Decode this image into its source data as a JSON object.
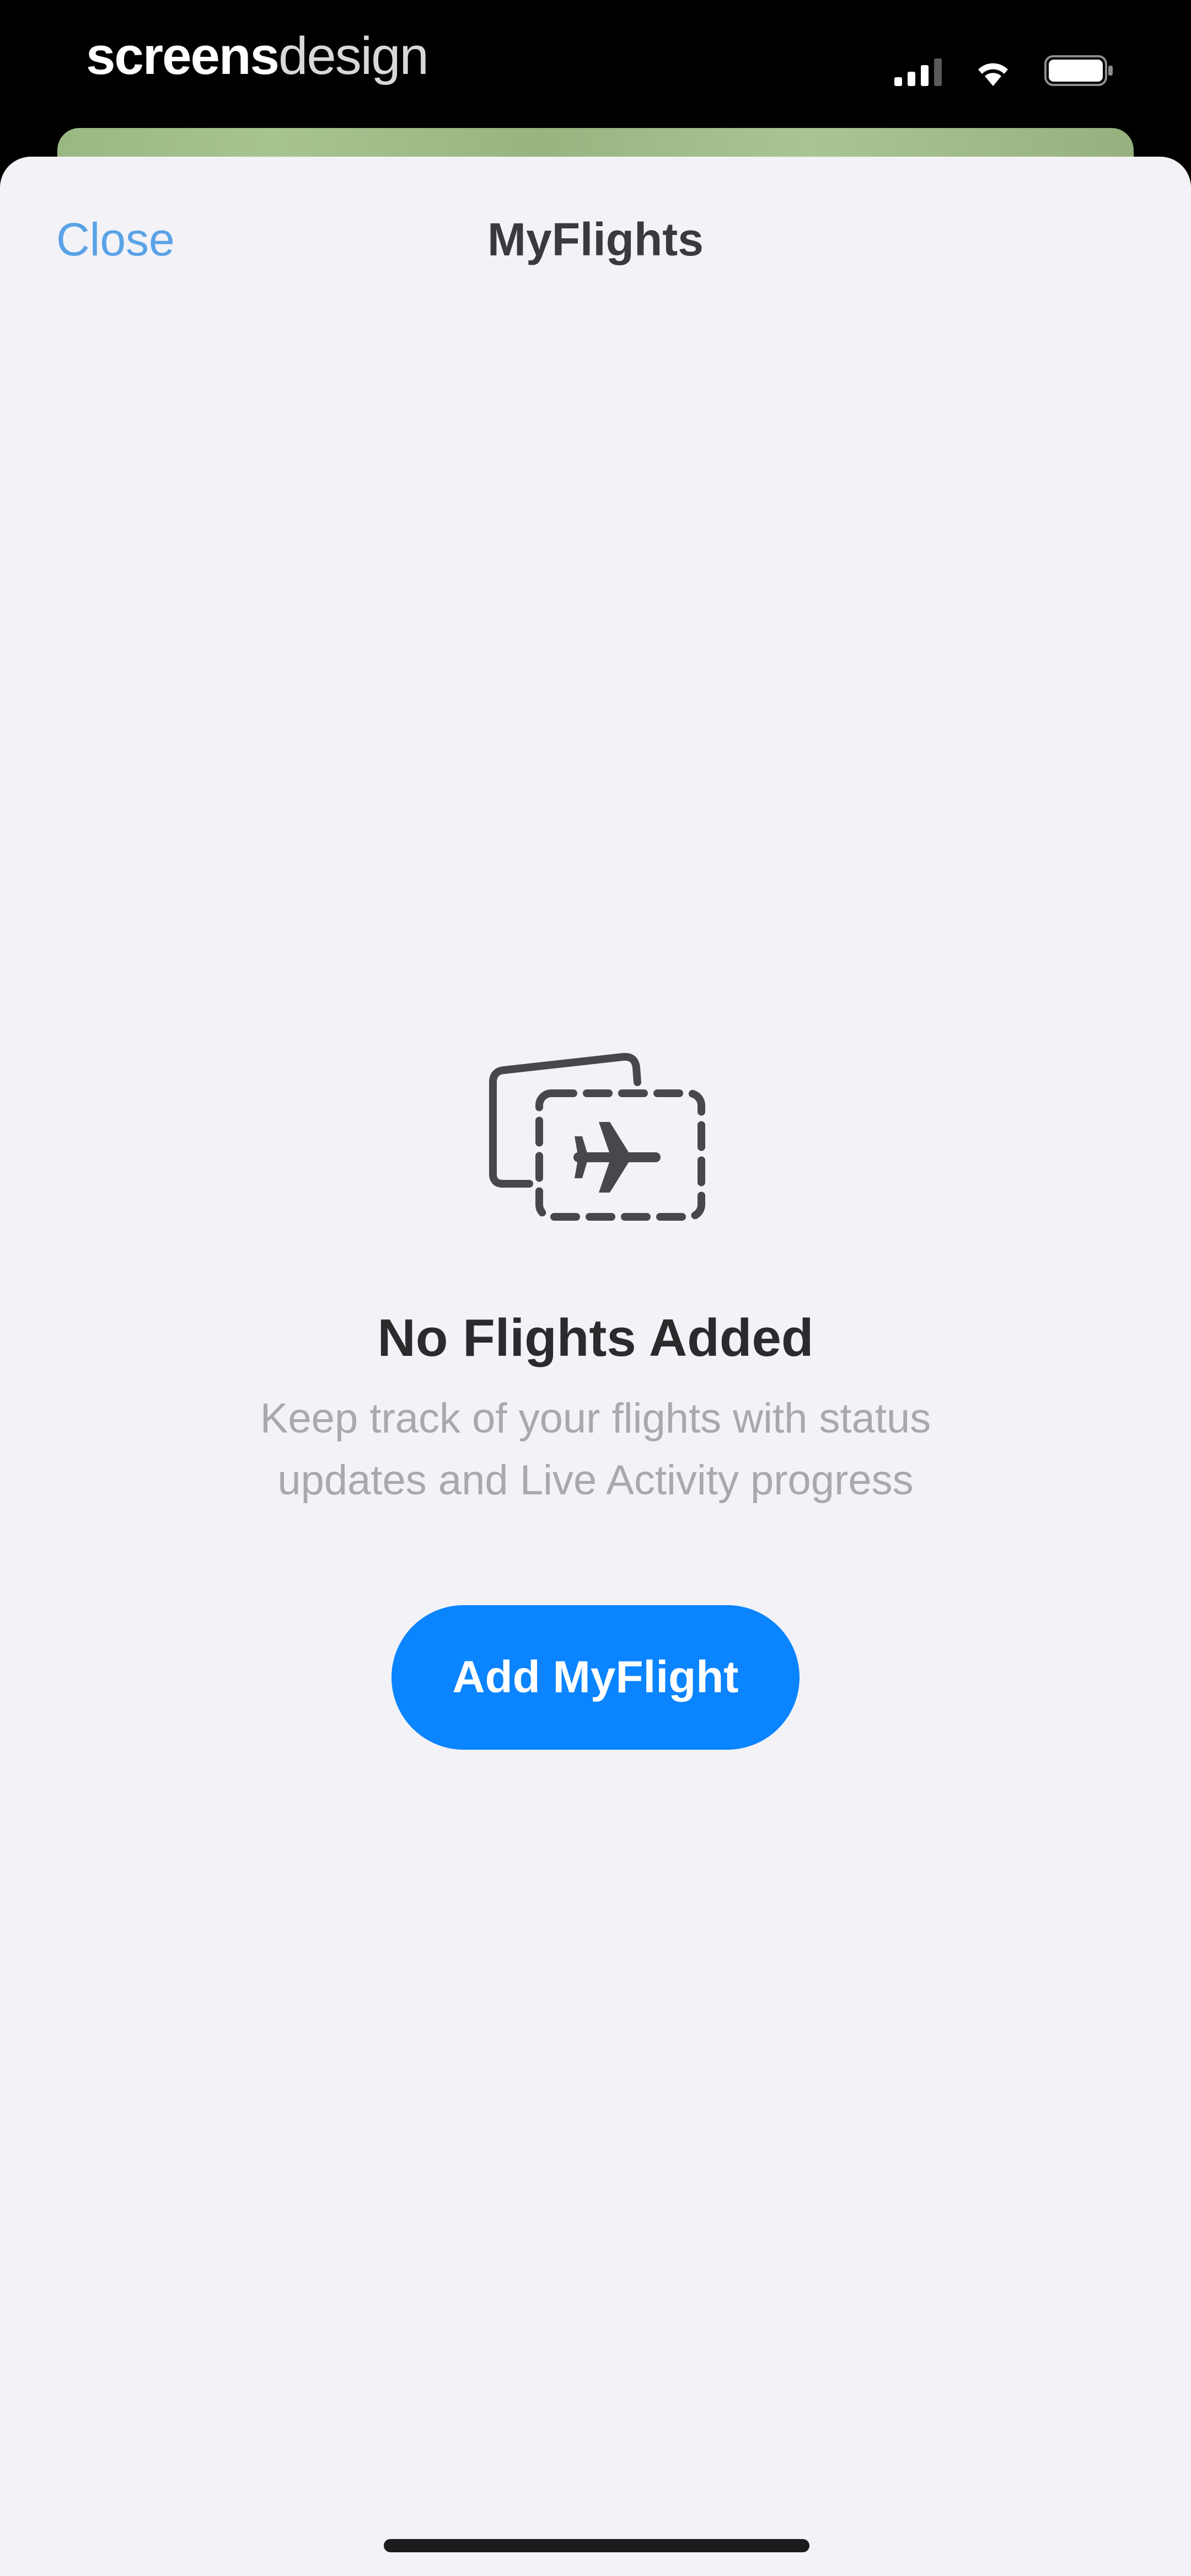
{
  "status_bar": {
    "watermark_bold": "screens",
    "watermark_light": "design",
    "icons": [
      "signal-icon",
      "wifi-icon",
      "battery-icon"
    ]
  },
  "nav": {
    "close_label": "Close",
    "title": "MyFlights"
  },
  "empty_state": {
    "icon": "flight-cards-icon",
    "title": "No Flights Added",
    "description": "Keep track of your flights with status updates and Live Activity progress",
    "button_label": "Add MyFlight"
  },
  "colors": {
    "accent": "#0a84ff",
    "close_link": "#5aa2e6",
    "sheet_background": "#f2f2f7",
    "title_text": "#2b2b2e",
    "secondary_text": "#a8a8ad"
  }
}
